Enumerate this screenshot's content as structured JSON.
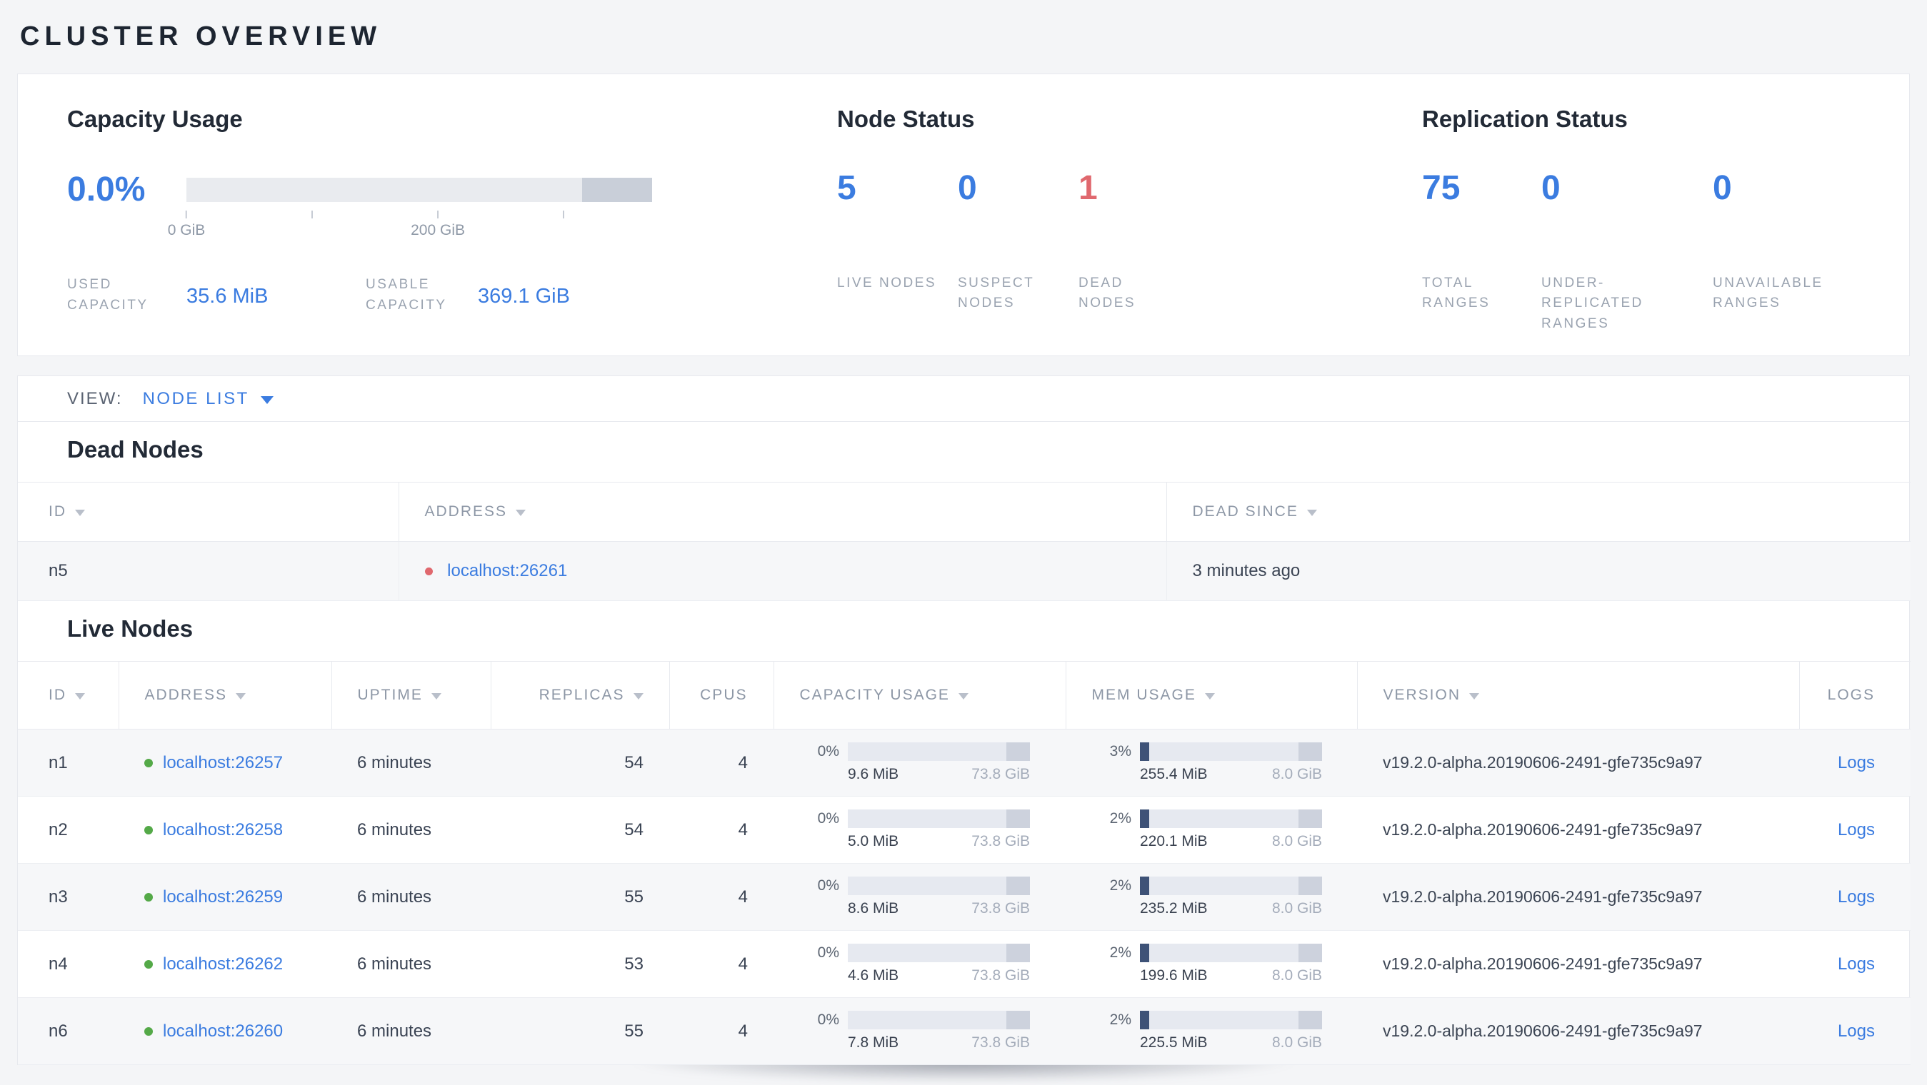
{
  "page": {
    "title": "CLUSTER OVERVIEW"
  },
  "colors": {
    "accent_blue": "#3b7ce0",
    "danger_red": "#e0686e",
    "live_green": "#54a948"
  },
  "capacity": {
    "title": "Capacity Usage",
    "percent": "0.0%",
    "used_pct": 0,
    "ticks": [
      {
        "label": "0 GiB",
        "pos": 0
      },
      {
        "label": "",
        "pos": 27
      },
      {
        "label": "200 GiB",
        "pos": 54
      },
      {
        "label": "",
        "pos": 81
      }
    ],
    "used_label": "USED CAPACITY",
    "used_value": "35.6 MiB",
    "usable_label": "USABLE CAPACITY",
    "usable_value": "369.1 GiB"
  },
  "node_status": {
    "title": "Node Status",
    "stats": [
      {
        "value": "5",
        "label": "LIVE NODES"
      },
      {
        "value": "0",
        "label": "SUSPECT NODES"
      },
      {
        "value": "1",
        "label": "DEAD NODES"
      }
    ]
  },
  "replication": {
    "title": "Replication Status",
    "stats": [
      {
        "value": "75",
        "label": "TOTAL RANGES"
      },
      {
        "value": "0",
        "label": "UNDER-REPLICATED RANGES"
      },
      {
        "value": "0",
        "label": "UNAVAILABLE RANGES"
      }
    ]
  },
  "view_bar": {
    "label": "VIEW:",
    "selected": "NODE LIST"
  },
  "dead_nodes": {
    "title": "Dead Nodes",
    "columns": {
      "id": "ID",
      "address": "ADDRESS",
      "dead_since": "DEAD SINCE"
    },
    "rows": [
      {
        "id": "n5",
        "address": "localhost:26261",
        "dead_since": "3 minutes ago"
      }
    ]
  },
  "live_nodes": {
    "title": "Live Nodes",
    "columns": {
      "id": "ID",
      "address": "ADDRESS",
      "uptime": "UPTIME",
      "replicas": "REPLICAS",
      "cpus": "CPUS",
      "capacity": "CAPACITY USAGE",
      "mem": "MEM USAGE",
      "version": "VERSION",
      "logs": "LOGS"
    },
    "rows": [
      {
        "id": "n1",
        "address": "localhost:26257",
        "uptime": "6 minutes",
        "replicas": "54",
        "cpus": "4",
        "capacity": {
          "percent": "0%",
          "pct": 0,
          "used": "9.6 MiB",
          "total": "73.8 GiB"
        },
        "mem": {
          "percent": "3%",
          "pct": 3,
          "used": "255.4 MiB",
          "total": "8.0 GiB"
        },
        "version": "v19.2.0-alpha.20190606-2491-gfe735c9a97",
        "logs_label": "Logs"
      },
      {
        "id": "n2",
        "address": "localhost:26258",
        "uptime": "6 minutes",
        "replicas": "54",
        "cpus": "4",
        "capacity": {
          "percent": "0%",
          "pct": 0,
          "used": "5.0 MiB",
          "total": "73.8 GiB"
        },
        "mem": {
          "percent": "2%",
          "pct": 2,
          "used": "220.1 MiB",
          "total": "8.0 GiB"
        },
        "version": "v19.2.0-alpha.20190606-2491-gfe735c9a97",
        "logs_label": "Logs"
      },
      {
        "id": "n3",
        "address": "localhost:26259",
        "uptime": "6 minutes",
        "replicas": "55",
        "cpus": "4",
        "capacity": {
          "percent": "0%",
          "pct": 0,
          "used": "8.6 MiB",
          "total": "73.8 GiB"
        },
        "mem": {
          "percent": "2%",
          "pct": 2,
          "used": "235.2 MiB",
          "total": "8.0 GiB"
        },
        "version": "v19.2.0-alpha.20190606-2491-gfe735c9a97",
        "logs_label": "Logs"
      },
      {
        "id": "n4",
        "address": "localhost:26262",
        "uptime": "6 minutes",
        "replicas": "53",
        "cpus": "4",
        "capacity": {
          "percent": "0%",
          "pct": 0,
          "used": "4.6 MiB",
          "total": "73.8 GiB"
        },
        "mem": {
          "percent": "2%",
          "pct": 2,
          "used": "199.6 MiB",
          "total": "8.0 GiB"
        },
        "version": "v19.2.0-alpha.20190606-2491-gfe735c9a97",
        "logs_label": "Logs"
      },
      {
        "id": "n6",
        "address": "localhost:26260",
        "uptime": "6 minutes",
        "replicas": "55",
        "cpus": "4",
        "capacity": {
          "percent": "0%",
          "pct": 0,
          "used": "7.8 MiB",
          "total": "73.8 GiB"
        },
        "mem": {
          "percent": "2%",
          "pct": 2,
          "used": "225.5 MiB",
          "total": "8.0 GiB"
        },
        "version": "v19.2.0-alpha.20190606-2491-gfe735c9a97",
        "logs_label": "Logs"
      }
    ]
  }
}
